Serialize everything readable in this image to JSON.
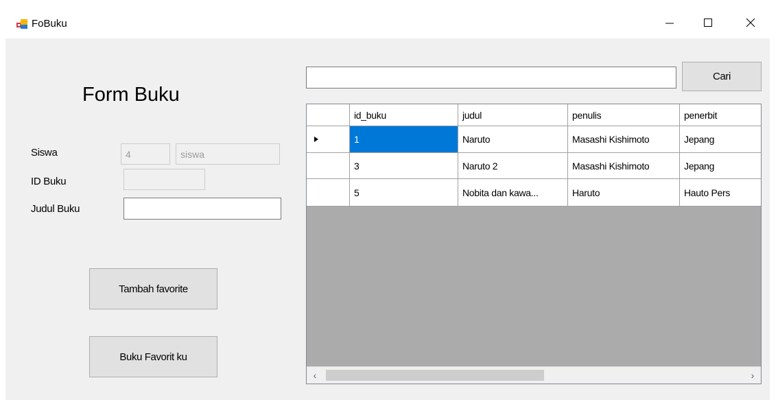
{
  "window": {
    "title": "FoBuku"
  },
  "form": {
    "heading": "Form Buku",
    "siswa_label": "Siswa",
    "siswa_id_value": "4",
    "siswa_name_value": "siswa",
    "id_buku_label": "ID Buku",
    "id_buku_value": "",
    "judul_buku_label": "Judul Buku",
    "judul_buku_value": "",
    "tambah_button": "Tambah favorite",
    "favorit_button": "Buku Favorit ku"
  },
  "search": {
    "value": "",
    "button": "Cari"
  },
  "grid": {
    "columns": [
      "id_buku",
      "judul",
      "penulis",
      "penerbit"
    ],
    "rows": [
      [
        "1",
        "Naruto",
        "Masashi Kishimoto",
        "Jepang"
      ],
      [
        "3",
        "Naruto 2",
        "Masashi Kishimoto",
        "Jepang"
      ],
      [
        "5",
        "Nobita dan kawa...",
        "Haruto",
        "Hauto Pers"
      ]
    ],
    "selected_row": 0
  },
  "icons": [
    "app-icon",
    "minimize-icon",
    "maximize-icon",
    "close-icon",
    "current-row-icon",
    "scroll-left-icon",
    "scroll-right-icon"
  ]
}
